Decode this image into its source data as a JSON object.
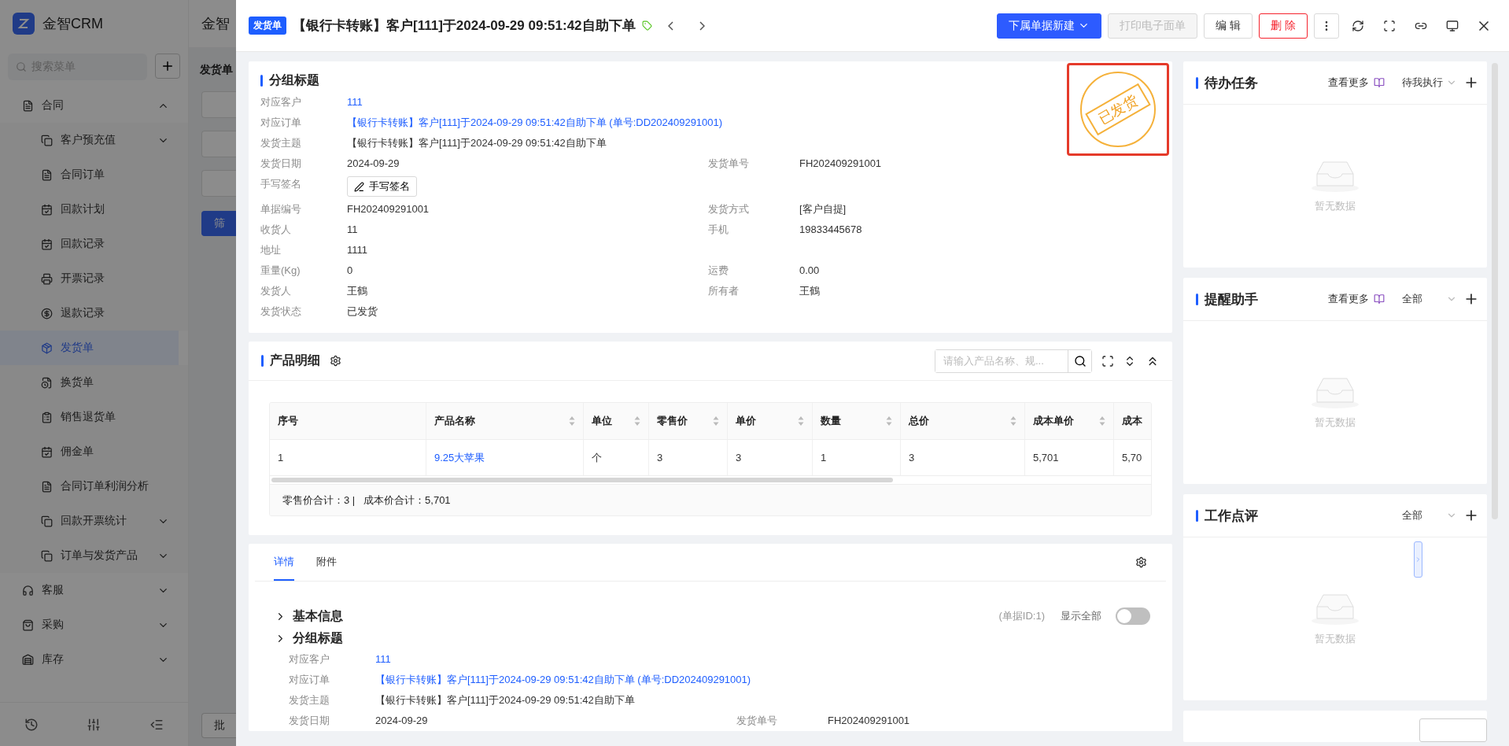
{
  "app": {
    "logo": "金智CRM",
    "top_title": "金智",
    "page_title": "发货单",
    "filter_button": "筛",
    "batch_button": "批"
  },
  "sidebar": {
    "search_placeholder": "搜索菜单",
    "items": [
      {
        "label": "合同",
        "expanded": true,
        "selected": false,
        "children": [
          {
            "label": "客户预充值",
            "expanded": false,
            "selected": false
          },
          {
            "label": "合同订单",
            "selected": false
          },
          {
            "label": "回款计划",
            "selected": false
          },
          {
            "label": "回款记录",
            "selected": false
          },
          {
            "label": "开票记录",
            "selected": false
          },
          {
            "label": "退款记录",
            "selected": false
          },
          {
            "label": "发货单",
            "selected": true
          },
          {
            "label": "换货单",
            "selected": false
          },
          {
            "label": "销售退货单",
            "selected": false
          },
          {
            "label": "佣金单",
            "selected": false
          },
          {
            "label": "合同订单利润分析",
            "selected": false
          },
          {
            "label": "回款开票统计",
            "expanded": false,
            "selected": false
          },
          {
            "label": "订单与发货产品",
            "expanded": false,
            "selected": false
          }
        ]
      },
      {
        "label": "客服",
        "expanded": false,
        "selected": false
      },
      {
        "label": "采购",
        "expanded": false,
        "selected": false
      },
      {
        "label": "库存",
        "expanded": false,
        "selected": false
      }
    ]
  },
  "drawer": {
    "tag": "发货单",
    "title": "【银行卡转账】客户[111]于2024-09-29 09:51:42自助下单",
    "buttons": [
      {
        "label": "下属单据新建",
        "kind": "primary",
        "disabled": false
      },
      {
        "label": "打印电子面单",
        "kind": "default",
        "disabled": true
      },
      {
        "label": "编 辑",
        "kind": "default",
        "disabled": false
      },
      {
        "label": "删 除",
        "kind": "danger",
        "disabled": false
      }
    ]
  },
  "info_card": {
    "title": "分组标题",
    "stamp": "已发货",
    "rows": [
      {
        "left": {
          "label": "对应客户",
          "value": "111",
          "kind": "link"
        }
      },
      {
        "left": {
          "label": "对应订单",
          "value": "【银行卡转账】客户[111]于2024-09-29 09:51:42自助下单 (单号:DD202409291001)",
          "kind": "link"
        }
      },
      {
        "left": {
          "label": "发货主题",
          "value": "【银行卡转账】客户[111]于2024-09-29 09:51:42自助下单",
          "kind": "text"
        }
      },
      {
        "left": {
          "label": "发货日期",
          "value": "2024-09-29",
          "kind": "text"
        },
        "right": {
          "label": "发货单号",
          "value": "FH202409291001",
          "kind": "text"
        }
      },
      {
        "left": {
          "label": "手写签名",
          "value": "手写签名",
          "kind": "signature"
        }
      },
      {
        "left": {
          "label": "单据编号",
          "value": "FH202409291001",
          "kind": "text"
        },
        "right": {
          "label": "发货方式",
          "value": "[客户自提]",
          "kind": "text"
        }
      },
      {
        "left": {
          "label": "收货人",
          "value": "11",
          "kind": "text"
        },
        "right": {
          "label": "手机",
          "value": "19833445678",
          "kind": "text"
        }
      },
      {
        "left": {
          "label": "地址",
          "value": "1111",
          "kind": "text"
        }
      },
      {
        "left": {
          "label": "重量(Kg)",
          "value": "0",
          "kind": "text"
        },
        "right": {
          "label": "运费",
          "value": "0.00",
          "kind": "text"
        }
      },
      {
        "left": {
          "label": "发货人",
          "value": "王鶴",
          "kind": "text"
        },
        "right": {
          "label": "所有者",
          "value": "王鶴",
          "kind": "text"
        }
      },
      {
        "left": {
          "label": "发货状态",
          "value": "已发货",
          "kind": "text"
        }
      }
    ]
  },
  "products": {
    "title": "产品明细",
    "search_placeholder": "请输入产品名称、规...",
    "columns": [
      {
        "label": "序号",
        "sortable": false
      },
      {
        "label": "产品名称",
        "sortable": true
      },
      {
        "label": "单位",
        "sortable": true
      },
      {
        "label": "零售价",
        "sortable": true
      },
      {
        "label": "单价",
        "sortable": true
      },
      {
        "label": "数量",
        "sortable": true
      },
      {
        "label": "总价",
        "sortable": true
      },
      {
        "label": "成本单价",
        "sortable": true
      },
      {
        "label": "成本"
      }
    ],
    "rows": [
      {
        "cells": [
          {
            "text": "1",
            "kind": "text"
          },
          {
            "text": "9.25大苹果",
            "kind": "link"
          },
          {
            "text": "个",
            "kind": "text"
          },
          {
            "text": "3",
            "kind": "text"
          },
          {
            "text": "3",
            "kind": "text"
          },
          {
            "text": "1",
            "kind": "text"
          },
          {
            "text": "3",
            "kind": "text"
          },
          {
            "text": "5,701",
            "kind": "text"
          },
          {
            "text": "5,70",
            "kind": "text"
          }
        ]
      }
    ],
    "summary": "零售价合计：3 |   成本价合计：5,701"
  },
  "detail": {
    "tabs": [
      {
        "label": "详情",
        "selected": true
      },
      {
        "label": "附件",
        "selected": false
      }
    ],
    "record_id": "(单据ID:1)",
    "show_all": {
      "label": "显示全部",
      "on": false
    },
    "sections": [
      {
        "title": "基本信息",
        "expanded": false
      },
      {
        "title": "分组标题",
        "expanded": false
      }
    ],
    "rows": [
      {
        "left": {
          "label": "对应客户",
          "value": "111",
          "kind": "link"
        }
      },
      {
        "left": {
          "label": "对应订单",
          "value": "【银行卡转账】客户[111]于2024-09-29 09:51:42自助下单 (单号:DD202409291001)",
          "kind": "link"
        }
      },
      {
        "left": {
          "label": "发货主题",
          "value": "【银行卡转账】客户[111]于2024-09-29 09:51:42自助下单",
          "kind": "text"
        }
      },
      {
        "left": {
          "label": "发货日期",
          "value": "2024-09-29",
          "kind": "text"
        },
        "right": {
          "label": "发货单号",
          "value": "FH202409291001",
          "kind": "text"
        }
      }
    ]
  },
  "side_panels": [
    {
      "title": "待办任务",
      "more": "查看更多",
      "filter": "待我执行",
      "empty": "暂无数据"
    },
    {
      "title": "提醒助手",
      "more": "查看更多",
      "filter": "全部",
      "empty": "暂无数据"
    },
    {
      "title": "工作点评",
      "filter": "全部",
      "empty": "暂无数据"
    }
  ]
}
